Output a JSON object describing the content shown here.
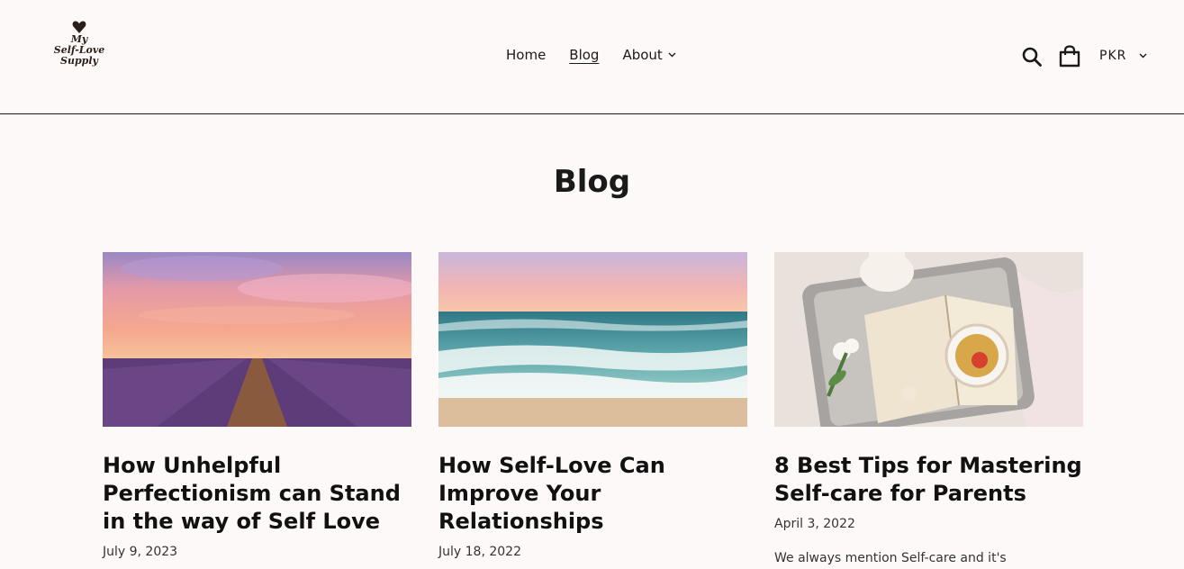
{
  "brand": {
    "logo_lines": [
      "My",
      "Self-Love",
      "Supply"
    ]
  },
  "nav": {
    "items": [
      {
        "label": "Home"
      },
      {
        "label": "Blog",
        "active": true
      },
      {
        "label": "About"
      }
    ]
  },
  "header": {
    "currency": "PKR",
    "icons": [
      "search-icon",
      "cart-icon",
      "chevron-down-icon"
    ]
  },
  "page": {
    "title": "Blog"
  },
  "articles": [
    {
      "title": "How Unhelpful Perfectionism can Stand in the way of Self Love",
      "date": "July 9, 2023",
      "image": "lavender-field-sunset"
    },
    {
      "title": "How Self-Love Can Improve Your Relationships",
      "date": "July 18, 2022",
      "image": "ocean-waves-beach"
    },
    {
      "title": "8 Best Tips for Mastering Self-care for Parents",
      "date": "April 3, 2022",
      "excerpt": "We always mention Self-care and it's",
      "image": "tea-tray-book"
    }
  ],
  "colors": {
    "background": "#fdf9f8",
    "text": "#1a1a1a",
    "logo": "#2b1f1a"
  }
}
